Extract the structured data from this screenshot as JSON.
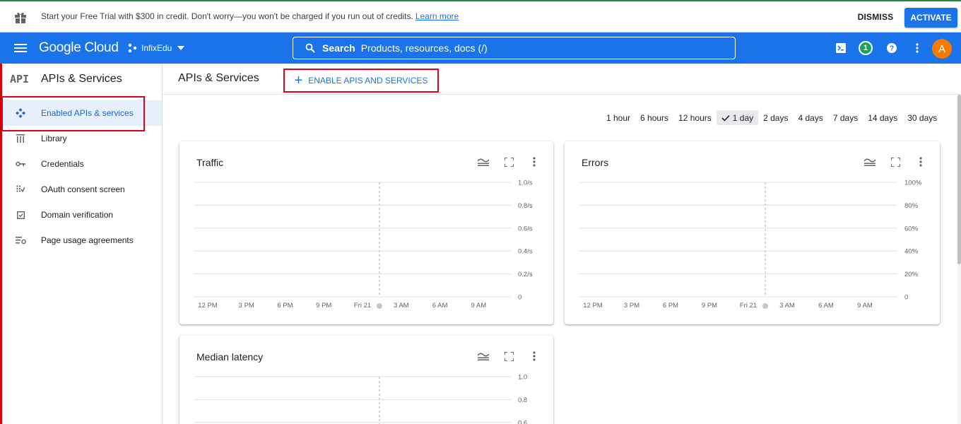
{
  "banner": {
    "message": "Start your Free Trial with $300 in credit. Don't worry—you won't be charged if you run out of credits.",
    "link": "Learn more",
    "dismiss": "DISMISS",
    "activate": "ACTIVATE"
  },
  "header": {
    "logo": "Google Cloud",
    "project": "InfixEdu",
    "search_label": "Search",
    "search_placeholder": "Products, resources, docs (/)",
    "notification_count": "1",
    "avatar_letter": "A"
  },
  "sidebar": {
    "badge": "API",
    "title": "APIs & Services",
    "items": [
      {
        "label": "Enabled APIs & services",
        "icon": "enabled-apis-icon"
      },
      {
        "label": "Library",
        "icon": "library-icon"
      },
      {
        "label": "Credentials",
        "icon": "key-icon"
      },
      {
        "label": "OAuth consent screen",
        "icon": "oauth-icon"
      },
      {
        "label": "Domain verification",
        "icon": "checkbox-icon"
      },
      {
        "label": "Page usage agreements",
        "icon": "settings-list-icon"
      }
    ]
  },
  "main": {
    "title": "APIs & Services",
    "enable_button": "ENABLE APIS AND SERVICES",
    "time_ranges": [
      "1 hour",
      "6 hours",
      "12 hours",
      "1 day",
      "2 days",
      "4 days",
      "7 days",
      "14 days",
      "30 days"
    ],
    "selected_range": "1 day"
  },
  "colors": {
    "brand_blue": "#1a73e8",
    "highlight_red": "#e1001a",
    "active_nav_bg": "#e8f0fe",
    "avatar": "#f57c00",
    "badge_green": "#1aa260"
  },
  "chart_data": [
    {
      "type": "line",
      "title": "Traffic",
      "x": [
        "12 PM",
        "3 PM",
        "6 PM",
        "9 PM",
        "Fri 21",
        "3 AM",
        "6 AM",
        "9 AM"
      ],
      "y_ticks": [
        "1.0/s",
        "0.8/s",
        "0.6/s",
        "0.4/s",
        "0.2/s",
        "0"
      ],
      "ylim": [
        0,
        1.0
      ],
      "series": [],
      "grid": true
    },
    {
      "type": "line",
      "title": "Errors",
      "x": [
        "12 PM",
        "3 PM",
        "6 PM",
        "9 PM",
        "Fri 21",
        "3 AM",
        "6 AM",
        "9 AM"
      ],
      "y_ticks": [
        "100%",
        "80%",
        "60%",
        "40%",
        "20%",
        "0"
      ],
      "ylim": [
        0,
        100
      ],
      "series": [],
      "grid": true
    },
    {
      "type": "line",
      "title": "Median latency",
      "x": [],
      "y_ticks": [
        "1.0",
        "0.8",
        "0.6"
      ],
      "ylim": [
        0,
        1.0
      ],
      "series": [],
      "grid": true
    }
  ]
}
